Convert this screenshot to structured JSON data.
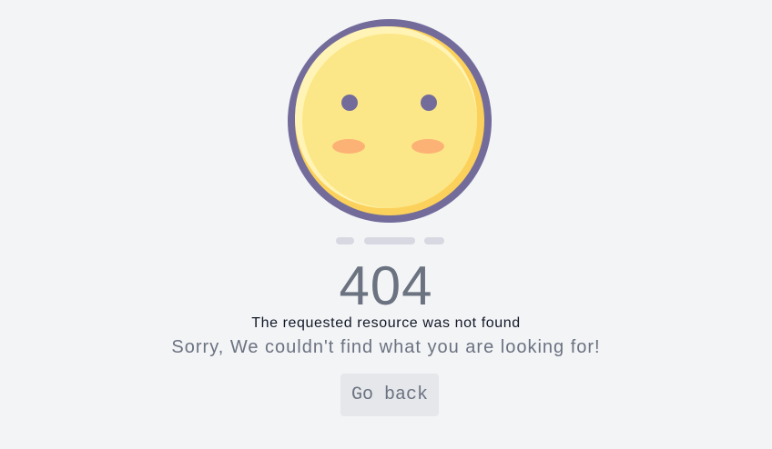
{
  "error": {
    "code": "404",
    "message": "The requested resource was not found",
    "description": "Sorry, We couldn't find what you are looking for!"
  },
  "actions": {
    "back_label": "Go back"
  },
  "illustration": {
    "icon": "sad-face-icon",
    "colors": {
      "outline": "#736c9b",
      "face": "#fce788",
      "face_shadow": "#fbd15b",
      "highlight": "#fff4b5",
      "eyes": "#736c9b",
      "cheeks": "#fdb275",
      "loader": "#d8d8e2"
    }
  }
}
